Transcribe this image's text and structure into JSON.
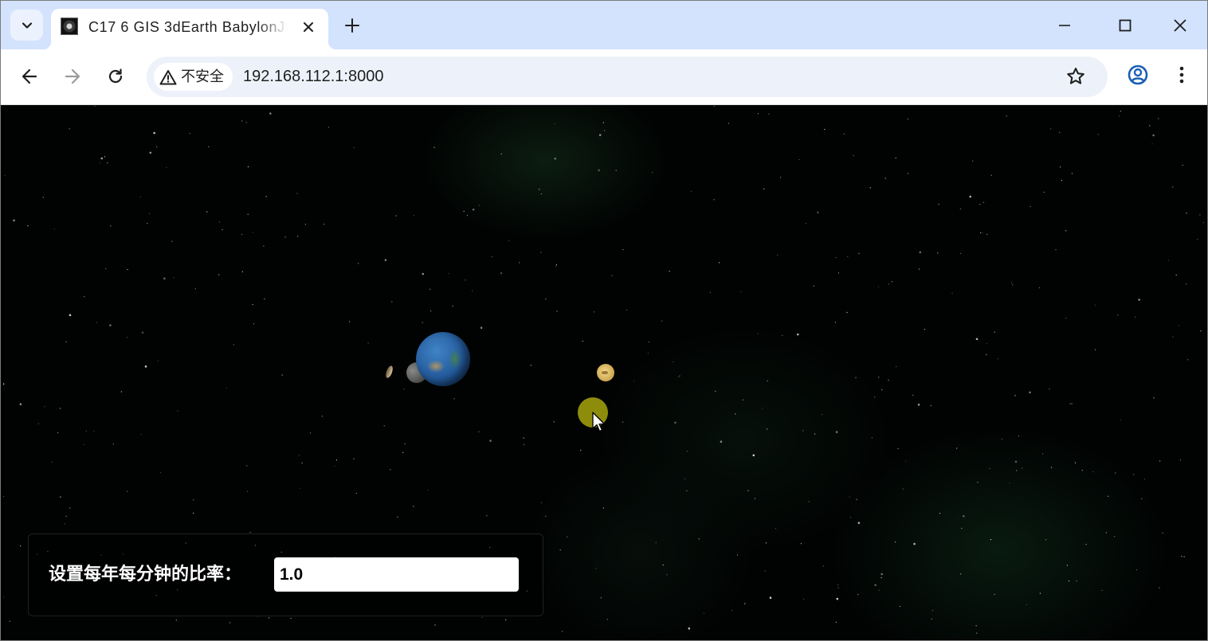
{
  "browser": {
    "tab": {
      "title": "C17  6  GIS  3dEarth  BabylonJS",
      "close_icon": "close-icon",
      "favicon": "favicon-icon"
    },
    "new_tab_icon": "plus-icon",
    "tab_search_icon": "chevron-down-icon",
    "window_controls": [
      "minimize-icon",
      "maximize-icon",
      "close-icon"
    ],
    "nav": [
      "back-icon",
      "forward-icon",
      "reload-icon"
    ],
    "security_label": "不安全",
    "url": "192.168.112.1:8000",
    "bookmark_icon": "star-icon",
    "profile_icon": "account-icon",
    "menu_icon": "more-vert-icon"
  },
  "scene": {
    "objects": [
      "earth",
      "moon",
      "sun"
    ],
    "click_indicator_color": "#8e8c0b"
  },
  "control_panel": {
    "label": "设置每年每分钟的比率：",
    "rate_value": "1.0"
  },
  "colors": {
    "tabstrip": "#d3e3fd",
    "omnibox": "#edf2fa",
    "background": "#010302"
  }
}
